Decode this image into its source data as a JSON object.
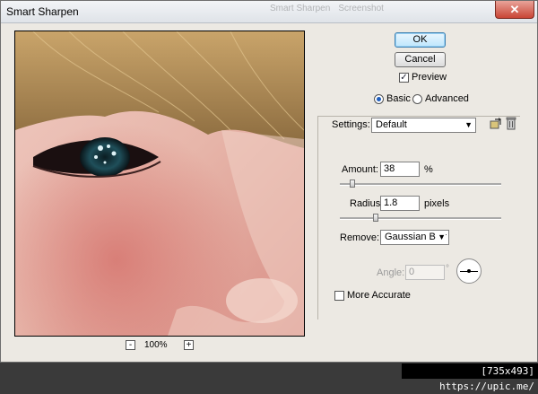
{
  "window": {
    "title": "Smart Sharpen",
    "close_glyph": "✕"
  },
  "background_window": {
    "tab_text_1": "Smart Sharpen",
    "tab_text_2": "Screenshot"
  },
  "buttons": {
    "ok": "OK",
    "cancel": "Cancel"
  },
  "preview": {
    "checked": true,
    "label": "Preview",
    "zoom_level": "100%",
    "zoom_minus": "-",
    "zoom_plus": "+"
  },
  "mode": {
    "basic_label": "Basic",
    "advanced_label": "Advanced",
    "selected": "Basic"
  },
  "settings": {
    "label": "Settings:",
    "value": "Default"
  },
  "amount": {
    "label": "Amount:",
    "value": "38",
    "unit": "%",
    "slider_fraction": 0.076
  },
  "radius": {
    "label": "Radius:",
    "value": "1.8",
    "unit": "pixels",
    "slider_fraction": 0.22
  },
  "remove": {
    "label": "Remove:",
    "value": "Gaussian Blur"
  },
  "angle": {
    "label": "Angle:",
    "value": "0",
    "unit": "°",
    "enabled": false
  },
  "more_accurate": {
    "label": "More Accurate",
    "checked": false
  },
  "watermark": {
    "text": "[735x493] https://upic.me/"
  },
  "icons": {
    "save_settings": "save-settings-icon",
    "delete_settings": "trash-icon"
  }
}
